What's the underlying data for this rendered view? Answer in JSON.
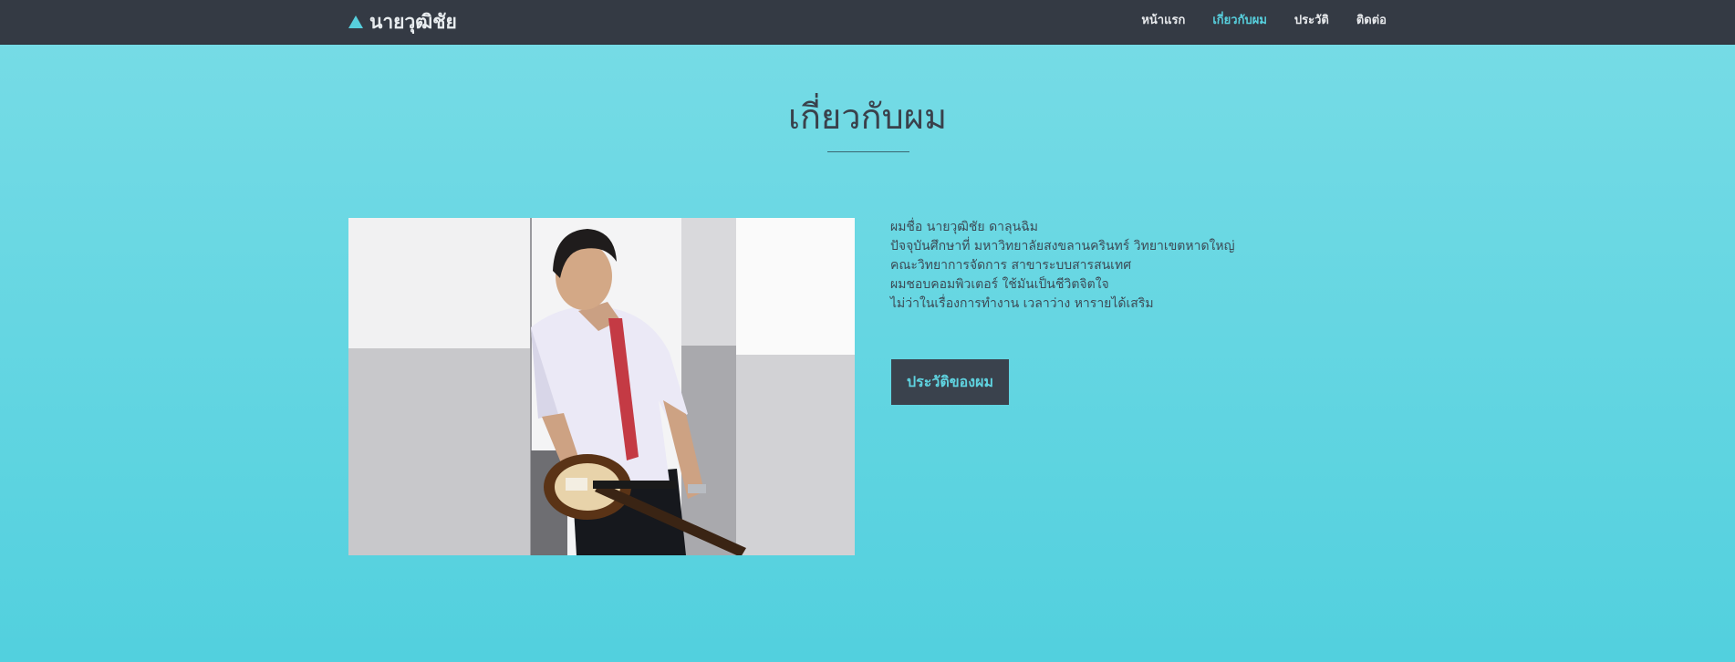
{
  "navbar": {
    "brand": "นายวุฒิชัย",
    "brand_icon": "triangle-logo-icon",
    "accent_color": "#57cfdd",
    "background_color": "#343a44",
    "links": [
      {
        "label": "หน้าแรก",
        "active": false
      },
      {
        "label": "เกี่ยวกับผม",
        "active": true
      },
      {
        "label": "ประวัติ",
        "active": false
      },
      {
        "label": "ติดต่อ",
        "active": false
      }
    ]
  },
  "about": {
    "title": "เกี่ยวกับผม",
    "bio_lines": [
      "ผมชื่อ นายวุฒิชัย ดาลุนฉิม",
      "ปัจจุบันศึกษาที่ มหาวิทยาลัยสงขลานครินทร์ วิทยาเขตหาดใหญ่",
      "คณะวิทยาการจัดการ สาขาระบบสารสนเทศ",
      "ผมชอบคอมพิวเตอร์ ใช้มันเป็นชีวิตจิตใจ",
      "ไม่ว่าในเรื่องการทำงาน เวลาว่าง หารายได้เสริม"
    ],
    "button_label": "ประวัติของผม"
  }
}
